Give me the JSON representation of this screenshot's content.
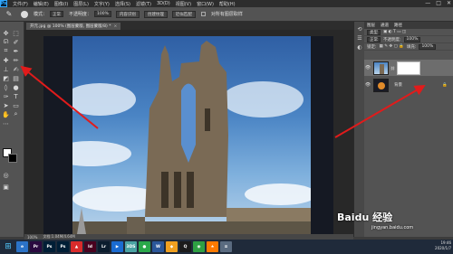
{
  "menubar": {
    "logo": "Ps",
    "items": [
      "文件(F)",
      "编辑(E)",
      "图像(I)",
      "图层(L)",
      "文字(Y)",
      "选择(S)",
      "滤镜(T)",
      "3D(D)",
      "视图(V)",
      "窗口(W)",
      "帮助(H)"
    ],
    "window_controls": [
      "—",
      "□",
      "✕"
    ]
  },
  "optbar": {
    "mode_label": "模式：",
    "mode_value": "正常",
    "opacity_label": "不透明度：",
    "opacity_value": "100%",
    "flow_label": "流量：",
    "flow_value": "100%",
    "buttons": [
      "内容识别",
      "创建纹理",
      "近似匹配"
    ],
    "sample_all": "对所有图层取样"
  },
  "document": {
    "tab_title": "开元.jpg @ 100% (图层蒙版, 图层蒙版/8) *",
    "close": "×"
  },
  "statusbar": {
    "zoom": "100%",
    "doc_info": "文档:1.04M/4.64M"
  },
  "layers_panel": {
    "tabs": [
      "图层",
      "通道",
      "路径"
    ],
    "kind_label": "类型",
    "blend_mode": "正常",
    "opacity_label": "不透明度:",
    "opacity_value": "100%",
    "lock_label": "锁定:",
    "fill_label": "填充:",
    "fill_value": "100%",
    "layers": [
      {
        "name": "",
        "has_mask": true
      },
      {
        "name": "背景",
        "has_mask": false
      }
    ]
  },
  "taskbar": {
    "apps": [
      {
        "label": "e",
        "color": "#2b73c7"
      },
      {
        "label": "Pr",
        "color": "#2a0a40"
      },
      {
        "label": "Ps",
        "color": "#001e36"
      },
      {
        "label": "Ps",
        "color": "#001e36"
      },
      {
        "label": "▲",
        "color": "#d92b2b"
      },
      {
        "label": "Id",
        "color": "#49021f"
      },
      {
        "label": "Lr",
        "color": "#0b1d2e"
      },
      {
        "label": "▶",
        "color": "#1a6bd1"
      },
      {
        "label": "3DS",
        "color": "#4aa3a3"
      },
      {
        "label": "●",
        "color": "#2aa84a"
      },
      {
        "label": "W",
        "color": "#2b579a"
      },
      {
        "label": "◆",
        "color": "#f0a020"
      },
      {
        "label": "Q",
        "color": "#1b1b1b"
      },
      {
        "label": "◉",
        "color": "#2ea043"
      },
      {
        "label": "★",
        "color": "#ff7a00"
      },
      {
        "label": "≡",
        "color": "#5a6b80"
      }
    ],
    "time": "19:46",
    "date": "2020/1/7"
  },
  "watermark": {
    "brand": "Baidu 经验",
    "site": "jingyan.baidu.com"
  },
  "colors": {
    "arrow": "#e11b1b",
    "selected_layer": "#6d6d6d"
  }
}
